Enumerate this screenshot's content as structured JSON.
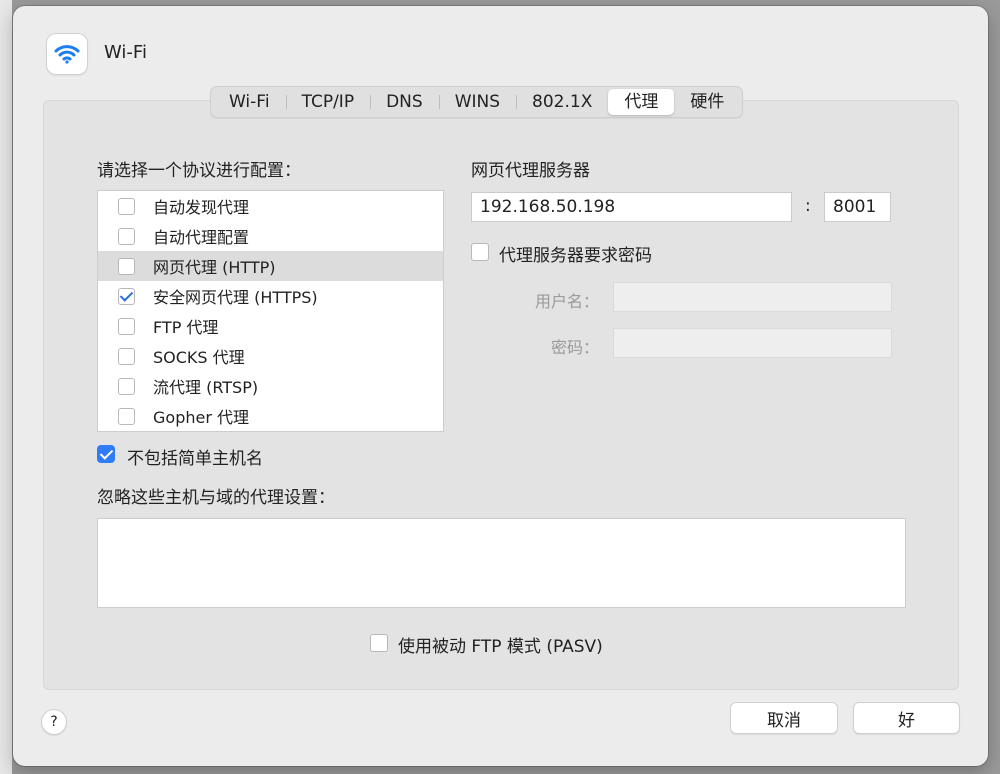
{
  "window": {
    "title": "Wi-Fi",
    "icon": "wifi-icon"
  },
  "tabs": [
    {
      "label": "Wi-Fi",
      "active": false
    },
    {
      "label": "TCP/IP",
      "active": false
    },
    {
      "label": "DNS",
      "active": false
    },
    {
      "label": "WINS",
      "active": false
    },
    {
      "label": "802.1X",
      "active": false
    },
    {
      "label": "代理",
      "active": true
    },
    {
      "label": "硬件",
      "active": false
    }
  ],
  "protocols": {
    "heading": "请选择一个协议进行配置：",
    "items": [
      {
        "label": "自动发现代理",
        "checked": false,
        "selected": false
      },
      {
        "label": "自动代理配置",
        "checked": false,
        "selected": false
      },
      {
        "label": "网页代理 (HTTP)",
        "checked": false,
        "selected": true
      },
      {
        "label": "安全网页代理 (HTTPS)",
        "checked": true,
        "selected": false
      },
      {
        "label": "FTP 代理",
        "checked": false,
        "selected": false
      },
      {
        "label": "SOCKS 代理",
        "checked": false,
        "selected": false
      },
      {
        "label": "流代理 (RTSP)",
        "checked": false,
        "selected": false
      },
      {
        "label": "Gopher 代理",
        "checked": false,
        "selected": false
      }
    ]
  },
  "proxy_server": {
    "heading": "网页代理服务器",
    "host": "192.168.50.198",
    "separator": ":",
    "port": "8001",
    "requires_password_label": "代理服务器要求密码",
    "requires_password": false,
    "username_label": "用户名：",
    "password_label": "密码："
  },
  "exclude_simple_hostnames": {
    "label": "不包括简单主机名",
    "checked": true
  },
  "bypass": {
    "label": "忽略这些主机与域的代理设置：",
    "value": ""
  },
  "passive_ftp": {
    "label": "使用被动 FTP 模式 (PASV)",
    "checked": false
  },
  "footer": {
    "help": "?",
    "cancel": "取消",
    "ok": "好"
  }
}
